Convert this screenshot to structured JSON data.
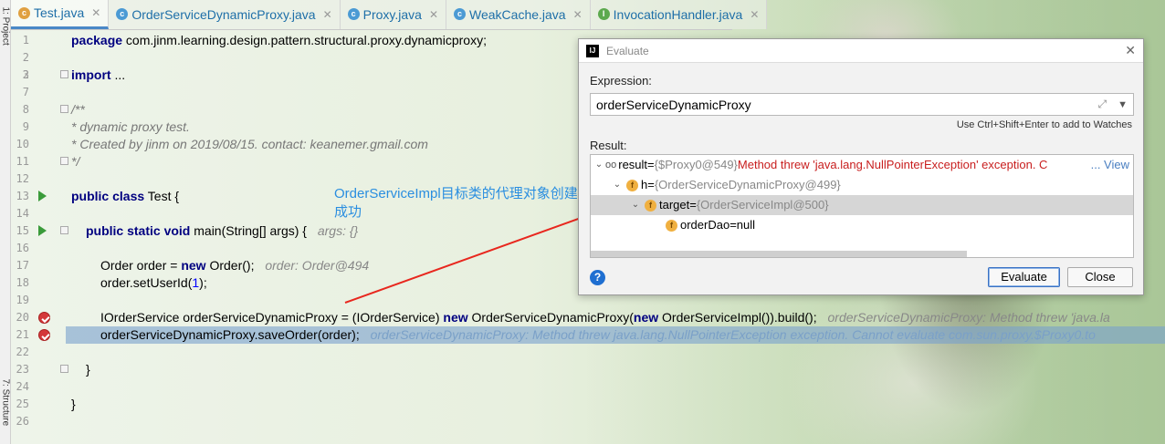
{
  "side": {
    "top_label": "1: Project",
    "bottom_label": "7: Structure"
  },
  "tabs": [
    {
      "label": "Test.java",
      "icon": "class-icon",
      "active": true
    },
    {
      "label": "OrderServiceDynamicProxy.java",
      "icon": "class-icon"
    },
    {
      "label": "Proxy.java",
      "icon": "class-icon"
    },
    {
      "label": "WeakCache.java",
      "icon": "class-icon"
    },
    {
      "label": "InvocationHandler.java",
      "icon": "interface-icon"
    }
  ],
  "line_numbers": [
    "1",
    "2",
    "3",
    "7",
    "8",
    "9",
    "10",
    "11",
    "12",
    "13",
    "14",
    "15",
    "16",
    "17",
    "18",
    "19",
    "20",
    "21",
    "22",
    "23",
    "24",
    "25",
    "26"
  ],
  "code": {
    "l1_kw": "package",
    "l1_rest": " com.jinm.learning.design.pattern.structural.proxy.dynamicproxy;",
    "l3_kw": "import",
    "l3_rest": " ...",
    "l8": "/**",
    "l9": " * dynamic  proxy   test.",
    "l10": " * Created by jinm on  2019/08/15.  contact: keanemer.gmail.com",
    "l11": " */",
    "l13_kw": "public class",
    "l13_rest": " Test {",
    "l15_kw": "public static void",
    "l15_rest": " main(String[] args) {",
    "l15_inline": "args: {}",
    "l17_a": "Order order = ",
    "l17_kw": "new",
    "l17_b": " Order();",
    "l17_inline": "order: Order@494",
    "l18_a": "order.setUserId(",
    "l18_num": "1",
    "l18_b": ");",
    "l20_a": "IOrderService orderServiceDynamicProxy = (IOrderService) ",
    "l20_kw1": "new",
    "l20_b": " OrderServiceDynamicProxy(",
    "l20_kw2": "new",
    "l20_c": " OrderServiceImpl()).build();",
    "l20_inline": "orderServiceDynamicProxy: Method threw 'java.la",
    "l21_code": "orderServiceDynamicProxy.saveOrder(order);",
    "l21_inline": "orderServiceDynamicProxy: Method threw  java.lang.NullPointerException  exception. Cannot evaluate com.sun.proxy.$Proxy0.to",
    "l23": "}",
    "l25": "}"
  },
  "annotation": {
    "text": "OrderServiceImpl目标类的代理对象创建成功",
    "color": "#2a8ee0"
  },
  "dialog": {
    "title": "Evaluate",
    "expression_label": "Expression:",
    "expression_value": "orderServiceDynamicProxy",
    "hint": "Use Ctrl+Shift+Enter to add to Watches",
    "result_label": "Result:",
    "nodes": [
      {
        "name": "result",
        "eq": " = ",
        "value": "{$Proxy0@549}",
        "error": " Method threw 'java.lang.NullPointerException' exception. C",
        "link": "... View"
      },
      {
        "name": "h",
        "eq": " = ",
        "value": "{OrderServiceDynamicProxy@499}"
      },
      {
        "name": "target",
        "eq": " = ",
        "value": "{OrderServiceImpl@500}"
      },
      {
        "name": "orderDao",
        "eq": " = ",
        "value": "null"
      }
    ],
    "evaluate_label": "Evaluate",
    "close_label": "Close"
  },
  "colors": {
    "accent": "#4a88c7",
    "keyword": "#000080",
    "error": "#c81e1e",
    "annotation": "#2a8ee0",
    "arrow": "#e8271e"
  }
}
